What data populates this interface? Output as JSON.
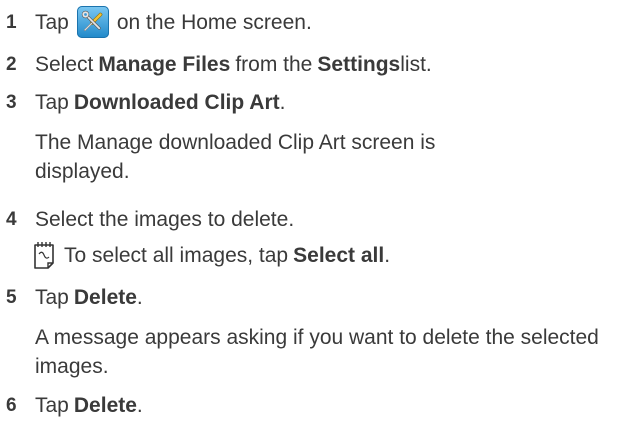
{
  "steps": [
    {
      "num": "1",
      "pre": "Tap",
      "icon": "tools-settings-icon",
      "post": "on the Home screen."
    },
    {
      "num": "2",
      "pre": "Select",
      "bold1": "Manage Files",
      "mid": "from the",
      "bold2": "Settings",
      "post": "list."
    },
    {
      "num": "3",
      "pre": "Tap",
      "bold1": "Downloaded Clip Art",
      "post": "."
    },
    {
      "num": "4",
      "text": "Select the images to delete."
    },
    {
      "num": "5",
      "pre": "Tap",
      "bold1": "Delete",
      "post": "."
    },
    {
      "num": "6",
      "pre": "Tap",
      "bold1": "Delete",
      "post": "."
    }
  ],
  "step3_result": "The Manage downloaded Clip Art screen is displayed.",
  "note": {
    "icon": "note-pad-icon",
    "pre": "To select all images, tap",
    "bold": "Select all",
    "post": "."
  },
  "step5_result": "A message appears asking if you want to delete the selected images.",
  "colors": {
    "text": "#3a3a3a",
    "icon_blue": "#1f88c9"
  }
}
